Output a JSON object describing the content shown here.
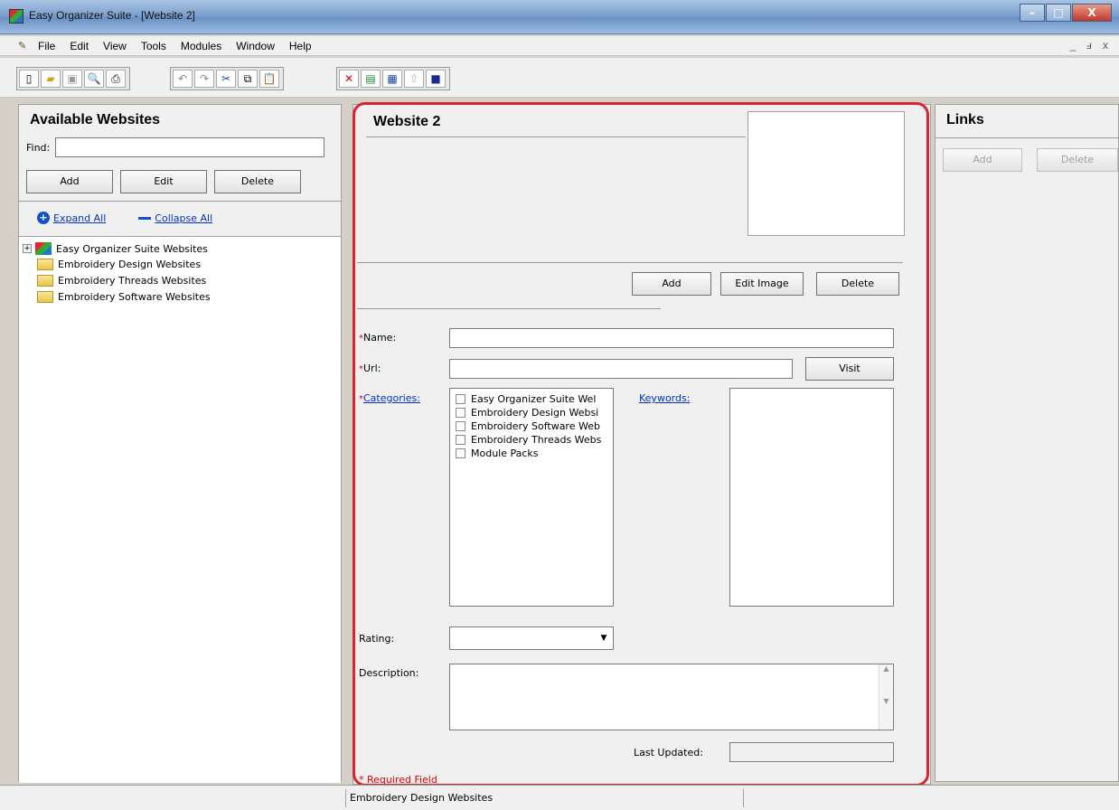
{
  "window": {
    "title": "Easy Organizer Suite - [Website 2]",
    "controls": [
      "–",
      "□",
      "X"
    ]
  },
  "menubar": {
    "items": [
      "File",
      "Edit",
      "View",
      "Tools",
      "Modules",
      "Window",
      "Help"
    ],
    "mdi_controls": [
      "_",
      "ⅎ",
      "x"
    ]
  },
  "toolbar": {
    "icons": [
      "new-icon",
      "open-icon",
      "save-icon",
      "print-preview-icon",
      "print-icon",
      "undo-icon",
      "redo-icon",
      "cut-icon",
      "copy-icon",
      "paste-icon",
      "delete-icon",
      "spreadsheet-icon",
      "grid-icon",
      "upload-icon",
      "monitor-icon"
    ]
  },
  "left_panel": {
    "header": "Available Websites",
    "find_label": "Find:",
    "find_value": "",
    "add_label": "Add",
    "edit_label": "Edit",
    "delete_label": "Delete",
    "expand_all": "Expand All",
    "collapse_all": "Collapse All",
    "tree": [
      {
        "label": "Easy Organizer Suite Websites",
        "expander": "+"
      },
      {
        "label": "Embroidery Design Websites"
      },
      {
        "label": "Embroidery Threads Websites"
      },
      {
        "label": "Embroidery Software Websites"
      }
    ]
  },
  "center_panel": {
    "title": "Website 2",
    "image_add_label": "Add",
    "image_edit_label": "Edit Image",
    "image_delete_label": "Delete",
    "required_marker": "*",
    "name_label": "Name:",
    "name_value": "",
    "url_label": "Url:",
    "url_value": "",
    "visit_label": "Visit",
    "categories_label": "Categories:",
    "categories": [
      "Easy Organizer Suite Wel",
      "Embroidery Design Websi",
      "Embroidery Software Web",
      "Embroidery Threads Webs",
      "Module Packs"
    ],
    "keywords_label": "Keywords:",
    "rating_label": "Rating:",
    "rating_value": "",
    "description_label": "Description:",
    "description_value": "",
    "last_updated_label": "Last Updated:",
    "last_updated_value": "",
    "required_note": "* Required Field"
  },
  "right_panel": {
    "header": "Links",
    "add_label": "Add",
    "delete_label": "Delete"
  },
  "statusbar": {
    "text": "Embroidery Design Websites"
  },
  "colors": {
    "highlight_outline": "#d6252e",
    "link": "#0033cc",
    "required": "#dd0000"
  }
}
